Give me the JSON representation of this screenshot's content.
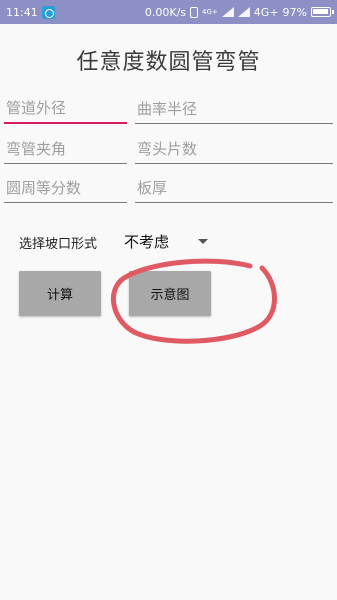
{
  "status_bar": {
    "time": "11:41",
    "speed": "0.00K/s",
    "network_tag_left": "4G+",
    "network_tag_left_sub": "¹",
    "network_label": "4G+",
    "battery": "97%"
  },
  "title": "任意度数圆管弯管",
  "fields": {
    "pipe_outer_diameter": "管道外径",
    "bend_radius": "曲率半径",
    "bend_angle": "弯管夹角",
    "bend_pieces": "弯头片数",
    "circle_divisions": "圆周等分数",
    "plate_thickness": "板厚"
  },
  "bevel": {
    "label": "选择坡口形式",
    "selected": "不考虑"
  },
  "buttons": {
    "calculate": "计算",
    "diagram": "示意图"
  },
  "colors": {
    "status_bar": "#8c90c4",
    "focus_underline": "#d81b60",
    "button_bg": "#a8a8a8",
    "annotation": "#e05a64"
  }
}
